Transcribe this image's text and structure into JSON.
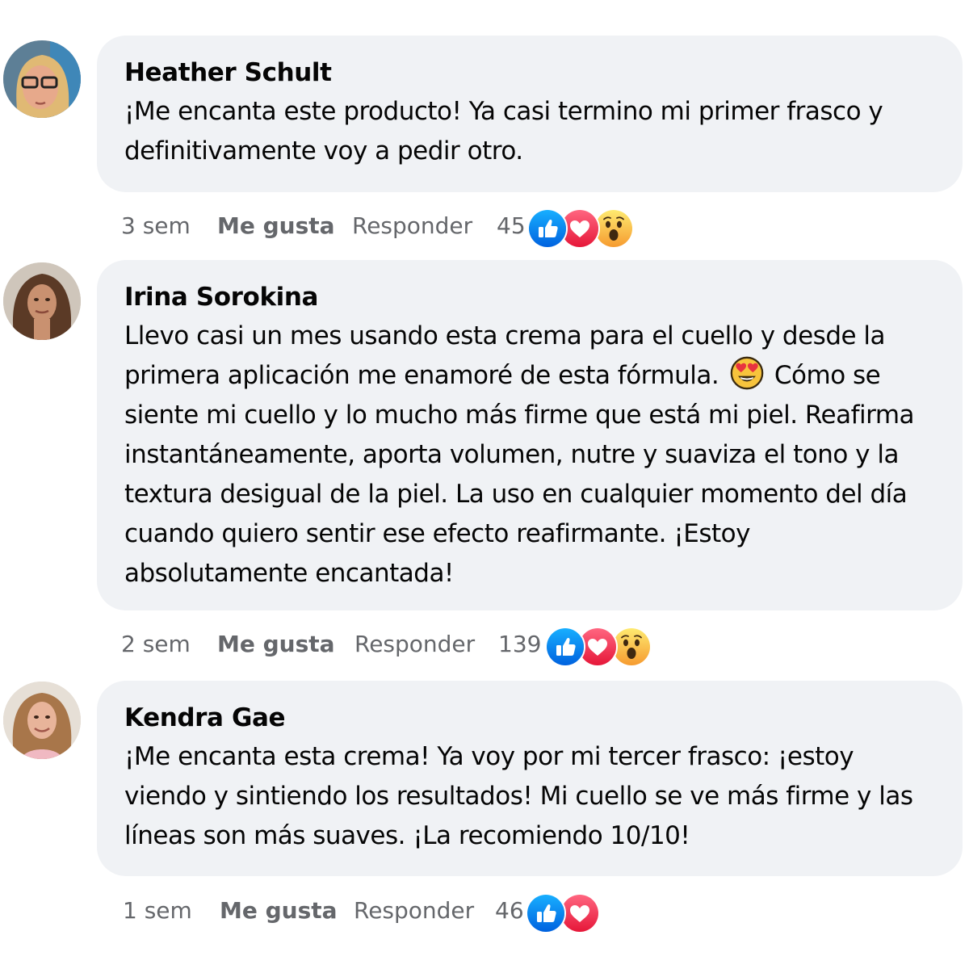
{
  "comments": [
    {
      "author": "Heather Schult",
      "text": "¡Me encanta este producto! Ya casi termino mi primer frasco y definitivamente voy a pedir otro.",
      "time": "3 sem",
      "like_label": "Me gusta",
      "reply_label": "Responder",
      "reaction_count": "45",
      "reactions": [
        "like-icon",
        "love-icon",
        "wow-icon"
      ]
    },
    {
      "author": "Irina Sorokina",
      "text_before_emoji": "Llevo casi un mes usando esta crema para el cuello y desde la primera aplicación me enamoré de esta fórmula.",
      "inline_emoji": "heart-eyes-emoji",
      "text_after_emoji": "Cómo se siente mi cuello y lo mucho más firme que está mi piel. Reafirma instantáneamente, aporta volumen, nutre y suaviza el tono y la textura desigual de la piel. La uso en cualquier momento del día cuando quiero sentir ese efecto reafirmante. ¡Estoy absolutamente encantada!",
      "time": "2 sem",
      "like_label": "Me gusta",
      "reply_label": "Responder",
      "reaction_count": "139",
      "reactions": [
        "like-icon",
        "love-icon",
        "wow-icon"
      ]
    },
    {
      "author": "Kendra Gae",
      "text": "¡Me encanta esta crema! Ya voy por mi tercer frasco: ¡estoy viendo y sintiendo los resultados! Mi cuello se ve más firme y las líneas son más suaves. ¡La recomiendo 10/10!",
      "time": "1 sem",
      "like_label": "Me gusta",
      "reply_label": "Responder",
      "reaction_count": "46",
      "reactions": [
        "like-icon",
        "love-icon"
      ]
    }
  ],
  "colors": {
    "bubble": "#f0f2f5",
    "meta_text": "#65676b",
    "like_blue": "#1877f2",
    "love_red": "#f33e58",
    "wow_yellow": "#f7b125"
  }
}
